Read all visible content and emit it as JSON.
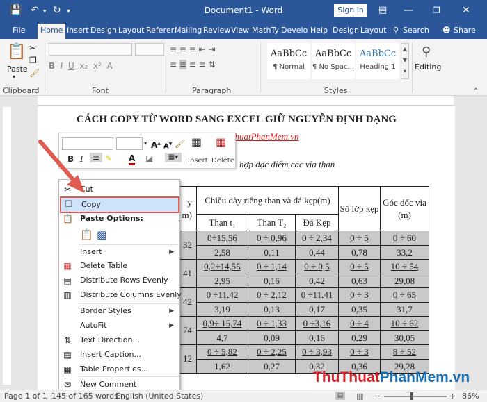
{
  "window": {
    "title": "Document1  -  Word",
    "sign_in": "Sign in",
    "share": "Share",
    "search": "Search"
  },
  "tabs": [
    "File",
    "Home",
    "Insert",
    "Design",
    "Layout",
    "Referer",
    "Mailing",
    "Review",
    "View",
    "MathTy",
    "Develo",
    "Help",
    "Design",
    "Layout"
  ],
  "ribbon": {
    "paste": "Paste",
    "clipboard": "Clipboard",
    "font": "Font",
    "paragraph": "Paragraph",
    "styles": "Styles",
    "editing": "Editing",
    "style_sample": "AaBbCc",
    "style_normal": "¶ Normal",
    "style_nospace": "¶ No Spac...",
    "style_heading": "Heading 1"
  },
  "document": {
    "heading": "CÁCH COPY TỪ WORD SANG EXCEL GIỮ NGUYÊN ĐỊNH DẠNG",
    "subheading": "ThuThuatPhanMem.vn",
    "caption": "hợp đặc điểm các vỉa than",
    "table": {
      "col1_partial_a": "y",
      "col1_partial_b": "m)",
      "group_header": "Chiều dày riêng than và đá kẹp(m)",
      "than_t1": "Than t₁",
      "than_t2": "Than T₂",
      "da_kep": "Đá Kẹp",
      "so_lop_kep": "Số lớp kẹp",
      "goc_doc_via": "Góc dốc vỉa (m)",
      "rows": [
        {
          "c0": "32",
          "c1a": "0÷15,56",
          "c1b": "2,58",
          "c2a": "0 ÷ 0,96",
          "c2b": "0,11",
          "c3a": "0 ÷ 2,34",
          "c3b": "0,44",
          "c4a": "0 ÷ 5",
          "c4b": "0,78",
          "c5a": "0 ÷ 60",
          "c5b": "33,2"
        },
        {
          "c0": "41",
          "c1a": "0,2÷14,55",
          "c1b": "2,95",
          "c2a": "0 ÷ 1,14",
          "c2b": "0,16",
          "c3a": "0 ÷ 0,5",
          "c3b": "0,42",
          "c4a": "0 ÷ 5",
          "c4b": "0,63",
          "c5a": "10 ÷ 54",
          "c5b": "29,08"
        },
        {
          "c0": "42",
          "c1a": "0 ÷11,42",
          "c1b": "3,19",
          "c2a": "0 ÷ 2,12",
          "c2b": "0,13",
          "c3a": "0 ÷11,41",
          "c3b": "0,17",
          "c4a": "0 ÷ 3",
          "c4b": "0,35",
          "c5a": "0 ÷ 65",
          "c5b": "31,7"
        },
        {
          "c0": "74",
          "c1a": "0,9÷ 15,74",
          "c1b": "4,7",
          "c2a": "0 ÷ 1,33",
          "c2b": "0,09",
          "c3a": "0 ÷3,16",
          "c3b": "0,16",
          "c4a": "0 ÷ 4",
          "c4b": "0,29",
          "c5a": "10 ÷ 62",
          "c5b": "30,05"
        },
        {
          "c0": "12",
          "c1a": "0 ÷ 5,82",
          "c1b": "1,62",
          "c2a": "0 ÷ 2,25",
          "c2b": "0,27",
          "c3a": "0 ÷ 3,93",
          "c3b": "0,32",
          "c4a": "0 ÷ 3",
          "c4b": "0,36",
          "c5a": "8 ÷ 52",
          "c5b": "29,28"
        }
      ]
    }
  },
  "mini_toolbar": {
    "insert": "Insert",
    "delete": "Delete",
    "bold": "B",
    "italic": "I"
  },
  "context_menu": {
    "cut": "Cut",
    "copy": "Copy",
    "paste_options": "Paste Options:",
    "insert": "Insert",
    "delete_table": "Delete Table",
    "distribute_rows": "Distribute Rows Evenly",
    "distribute_cols": "Distribute Columns Evenly",
    "border_styles": "Border Styles",
    "autofit": "AutoFit",
    "text_direction": "Text Direction...",
    "insert_caption": "Insert Caption...",
    "table_properties": "Table Properties...",
    "new_comment": "New Comment",
    "highlight_color": "#e05a52"
  },
  "status": {
    "page": "Page 1 of 1",
    "words": "145 of 165 words",
    "language": "English (United States)",
    "zoom": "86%"
  },
  "watermark": {
    "part1": "Thu",
    "part2": "Thuat",
    "part3": "PhanMem",
    "part4": ".vn",
    "color_red": "#d9252a",
    "color_blue": "#1a6fb5"
  }
}
